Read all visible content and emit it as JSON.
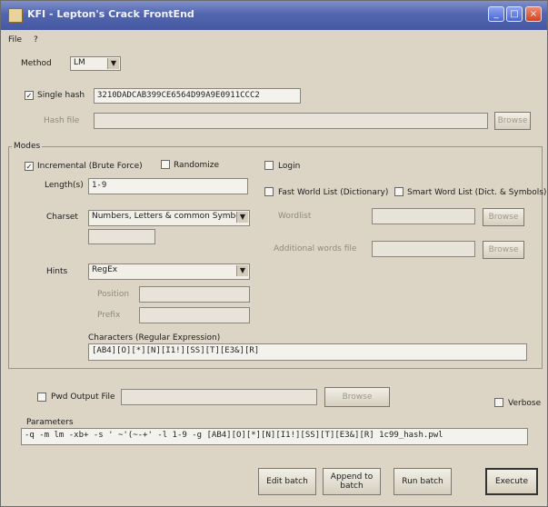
{
  "window": {
    "title": "KFI - Lepton's Crack FrontEnd",
    "min_glyph": "_",
    "max_glyph": "□",
    "close_glyph": "×"
  },
  "menu": {
    "file": "File",
    "help": "?"
  },
  "method": {
    "label": "Method",
    "value": "LM",
    "arrow": "▼"
  },
  "single_hash": {
    "checkbox": "✓",
    "label": "Single hash",
    "value": "3210DADCAB399CE6564D99A9E0911CCC2"
  },
  "hash_file": {
    "label": "Hash file",
    "value": "",
    "browse": "Browse"
  },
  "modes": {
    "title": "Modes",
    "incremental": {
      "checkbox": "✓",
      "label": "Incremental (Brute Force)"
    },
    "randomize": {
      "label": "Randomize"
    },
    "login": {
      "label": "Login"
    },
    "length_label": "Length(s)",
    "length_value": "1-9",
    "charset_label": "Charset",
    "charset_value": "Numbers, Letters & common Symbols",
    "charset_arrow": "▼",
    "charset_custom": "",
    "hints_label": "Hints",
    "hints_value": "RegEx",
    "hints_arrow": "▼",
    "position_label": "Position",
    "position_value": "",
    "prefix_label": "Prefix",
    "prefix_value": "",
    "regex_label": "Characters (Regular Expression)",
    "regex_value": "[AB4][O][*][N][I1!][SS][T][E3&][R]",
    "fast_wordlist": "Fast World List (Dictionary)",
    "smart_wordlist": "Smart Word List (Dict. & Symbols)",
    "wordlist_label": "Wordlist",
    "wordlist_value": "",
    "wordlist_browse": "Browse",
    "extra_label": "Additional words file",
    "extra_value": "",
    "extra_browse": "Browse"
  },
  "pwd_output": {
    "label": "Pwd Output File",
    "value": "",
    "browse": "Browse"
  },
  "verbose": {
    "label": "Verbose"
  },
  "parameters": {
    "label": "Parameters",
    "value": "-q -m lm -xb+ -s ' ~'(~-+' -l 1-9 -g [AB4][O][*][N][I1!][SS][T][E3&][R] 1c99_hash.pwl"
  },
  "buttons": {
    "edit_batch": "Edit batch",
    "append_batch": "Append to batch",
    "run_batch": "Run batch",
    "execute": "Execute"
  }
}
